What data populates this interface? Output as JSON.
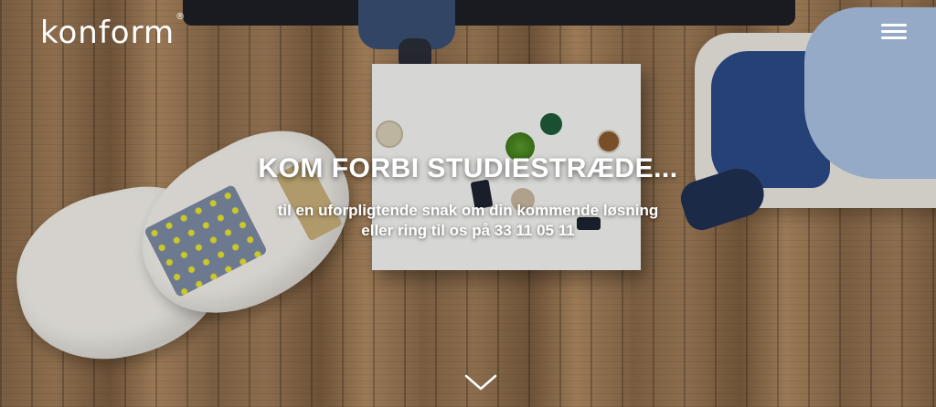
{
  "brand": {
    "logo_text": "konform",
    "trademark": "®"
  },
  "hero": {
    "headline": "KOM FORBI STUDIESTRÆDE...",
    "subline_1": "til en uforpligtende snak om din kommende løsning",
    "subline_2": "eller ring til os på 33 11 05 11"
  },
  "icons": {
    "menu": "hamburger-menu-icon",
    "scroll": "chevron-down-icon"
  },
  "colors": {
    "text": "#ffffff",
    "wood": "#8f6e4d"
  }
}
